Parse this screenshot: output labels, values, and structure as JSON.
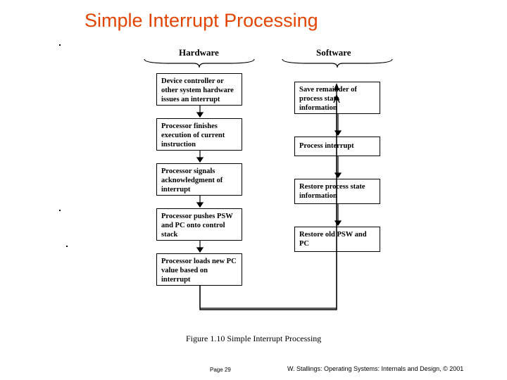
{
  "title": "Simple Interrupt Processing",
  "columns": {
    "hardware": "Hardware",
    "software": "Software"
  },
  "hw_boxes": {
    "b1": "Device controller or other system hardware issues an interrupt",
    "b2": "Processor finishes execution of current instruction",
    "b3": "Processor signals acknowledgment of interrupt",
    "b4": "Processor pushes PSW and PC onto control stack",
    "b5": "Processor loads new PC value based on interrupt"
  },
  "sw_boxes": {
    "b6": "Save remainder of process state information",
    "b7": "Process interrupt",
    "b8": "Restore process state information",
    "b9": "Restore old PSW and PC"
  },
  "caption": "Figure 1.10    Simple Interrupt Processing",
  "footer": {
    "page": "Page 29",
    "attr": "W. Stallings: Operating Systems: Internals and Design, © 2001"
  }
}
